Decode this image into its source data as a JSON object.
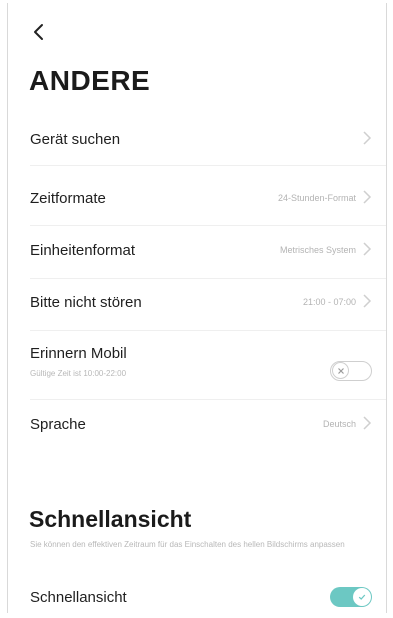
{
  "header": {
    "title": "ANDERE"
  },
  "settings": {
    "find_device": {
      "label": "Gerät suchen"
    },
    "time_format": {
      "label": "Zeitformate",
      "value": "24-Stunden-Format"
    },
    "unit_format": {
      "label": "Einheitenformat",
      "value": "Metrisches System"
    },
    "do_not_disturb": {
      "label": "Bitte nicht stören",
      "value": "21:00 - 07:00"
    },
    "remind_mobile": {
      "label": "Erinnern Mobil",
      "sublabel": "Gültige Zeit ist 10:00-22:00",
      "enabled": false
    },
    "language": {
      "label": "Sprache",
      "value": "Deutsch"
    }
  },
  "quick_view": {
    "section_title": "Schnellansicht",
    "description": "Sie können den effektiven Zeitraum für das Einschalten des hellen Bildschirms anpassen",
    "toggle_label": "Schnellansicht",
    "enabled": true
  },
  "colors": {
    "toggle_on": "#6cc8c3",
    "toggle_off_border": "#cfcfcf",
    "value_text": "#b3b3b3",
    "chevron": "#cfcfcf"
  },
  "icons": {
    "back": "chevron-left-icon",
    "row_arrow": "chevron-right-icon",
    "toggle_off_mark": "close-icon",
    "toggle_on_mark": "check-icon"
  }
}
